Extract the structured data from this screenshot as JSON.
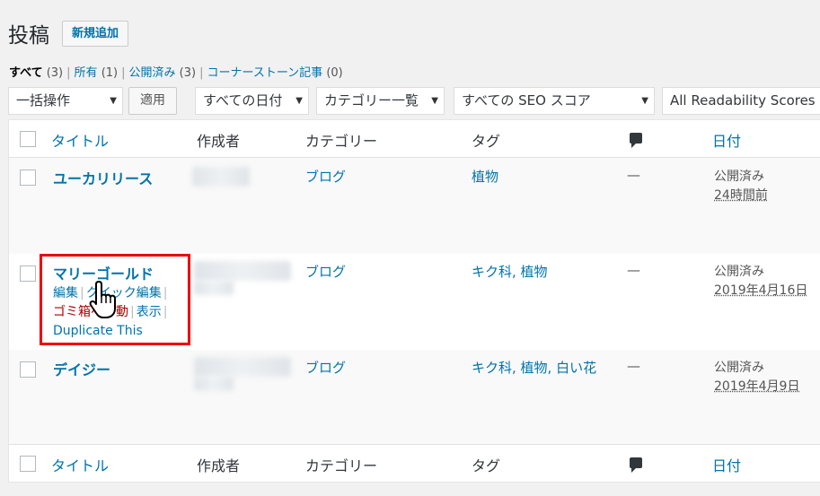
{
  "header": {
    "title": "投稿",
    "add_new": "新規追加"
  },
  "views": [
    {
      "label": "すべて",
      "count": "(3)",
      "current": true
    },
    {
      "label": "所有",
      "count": "(1)"
    },
    {
      "label": "公開済み",
      "count": "(3)"
    },
    {
      "label": "コーナーストーン記事",
      "count": "(0)"
    }
  ],
  "filters": {
    "bulk": "一括操作",
    "apply": "適用",
    "dates": "すべての日付",
    "categories": "カテゴリー一覧",
    "seo": "すべての SEO スコア",
    "readability": "All Readability Scores"
  },
  "columns": {
    "title": "タイトル",
    "author": "作成者",
    "category": "カテゴリー",
    "tags": "タグ",
    "date": "日付"
  },
  "posts": [
    {
      "title": "ユーカリリース",
      "category": "ブログ",
      "tags": "植物",
      "comments": "—",
      "status": "公開済み",
      "date": "24時間前"
    },
    {
      "title": "マリーゴールド",
      "category": "ブログ",
      "tags": "キク科, 植物",
      "comments": "—",
      "status": "公開済み",
      "date": "2019年4月16日",
      "actions": {
        "edit": "編集",
        "quick_edit": "クイック編集",
        "trash": "ゴミ箱へ移動",
        "view": "表示",
        "duplicate": "Duplicate This"
      }
    },
    {
      "title": "デイジー",
      "category": "ブログ",
      "tags": "キク科, 植物, 白い花",
      "comments": "—",
      "status": "公開済み",
      "date": "2019年4月9日"
    }
  ],
  "icons": {
    "comments": "comment-bubble-icon",
    "cursor": "hand-pointer-icon"
  },
  "colors": {
    "link": "#0073aa",
    "highlight": "#e00000",
    "trash": "#a00000"
  }
}
